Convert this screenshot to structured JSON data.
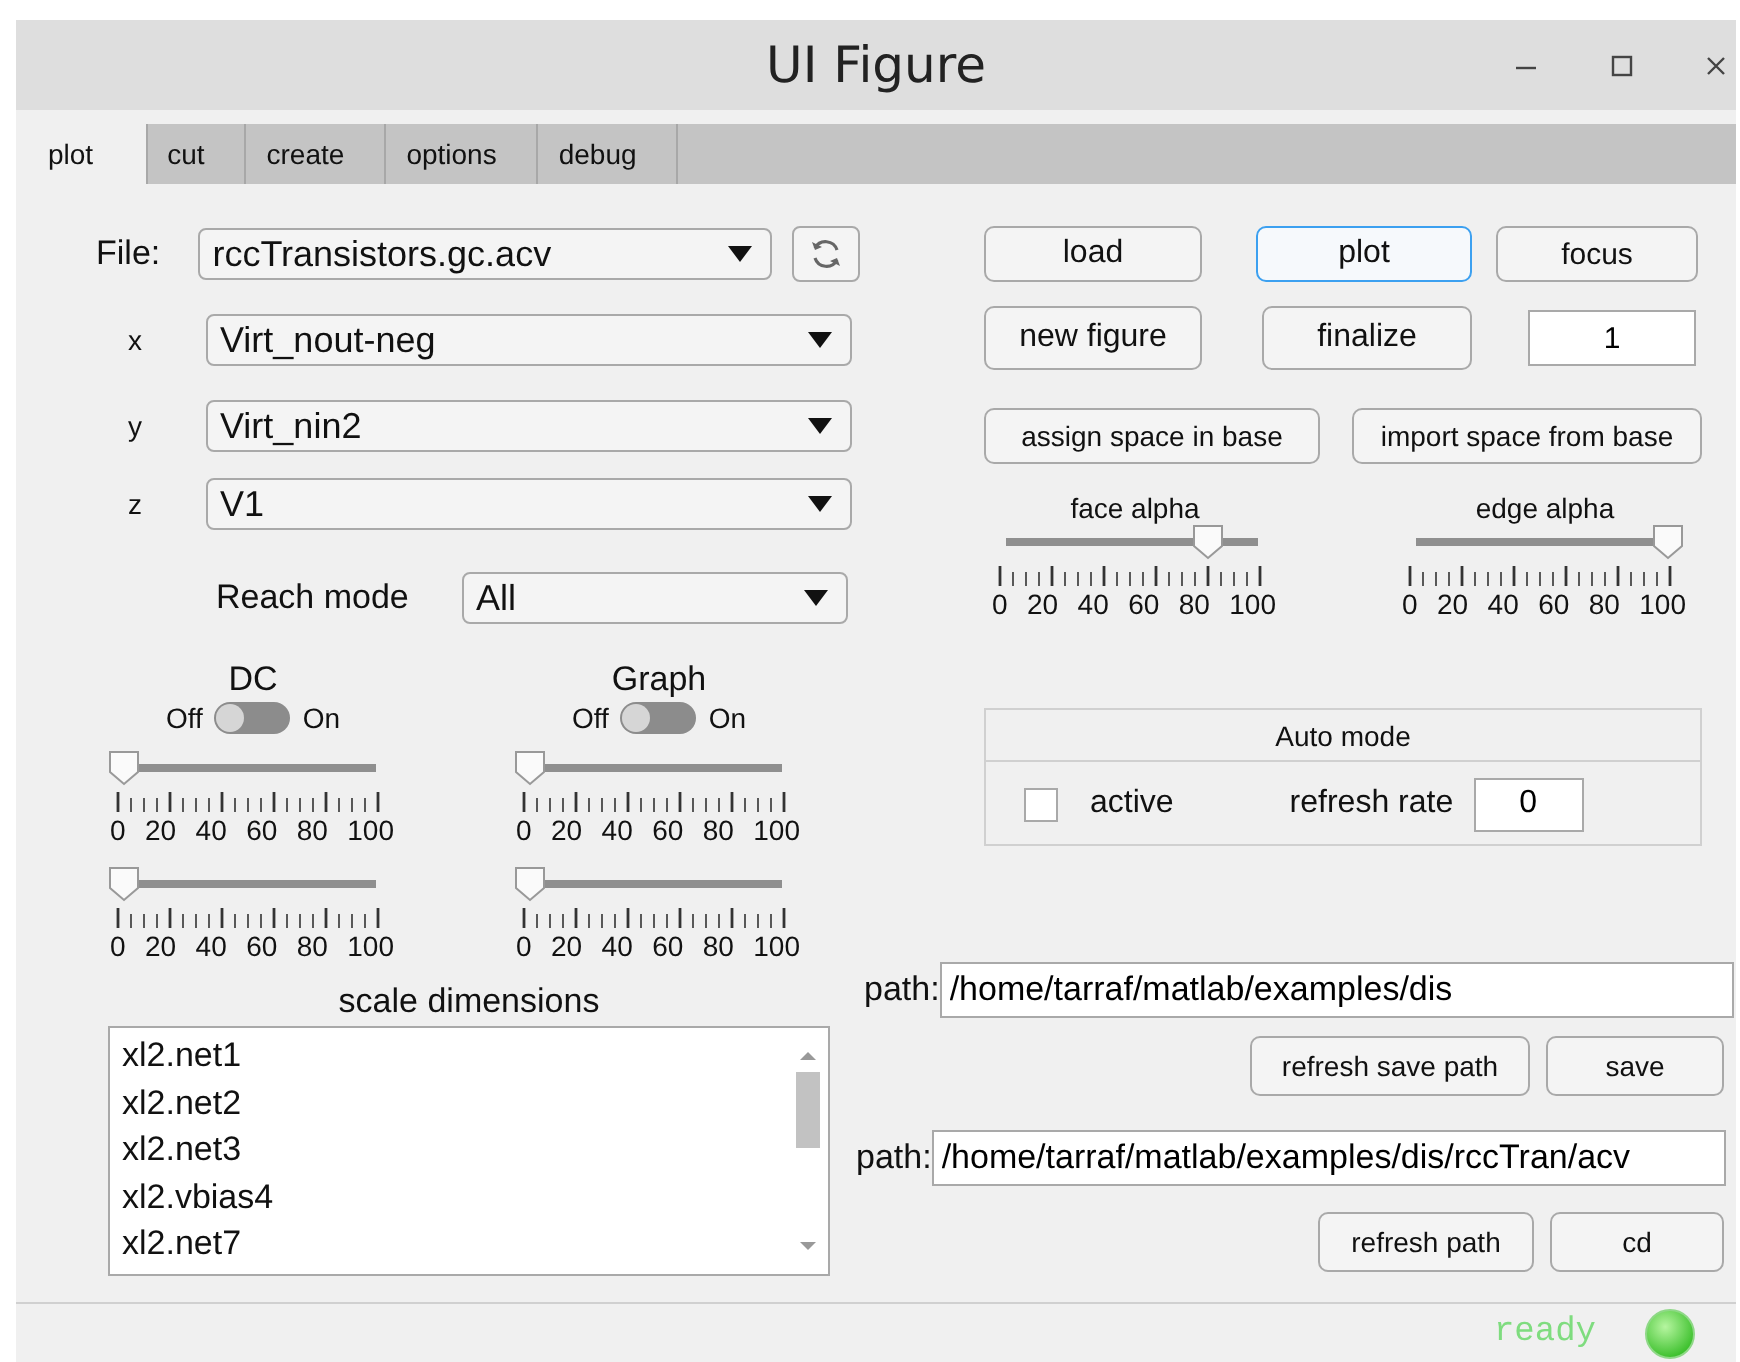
{
  "window": {
    "title": "UI Figure"
  },
  "tabs": [
    {
      "label": "plot",
      "selected": true
    },
    {
      "label": "cut",
      "selected": false
    },
    {
      "label": "create",
      "selected": false
    },
    {
      "label": "options",
      "selected": false
    },
    {
      "label": "debug",
      "selected": false
    }
  ],
  "file": {
    "label": "File:",
    "value": "rccTransistors.gc.acv"
  },
  "variables": [
    {
      "label": "x",
      "value": "Virt_nout-neg"
    },
    {
      "label": "y",
      "value": "Virt_nin2"
    },
    {
      "label": "z",
      "value": "V1"
    }
  ],
  "reach_mode": {
    "label": "Reach mode",
    "value": "All"
  },
  "toggles": [
    {
      "title": "DC",
      "off_label": "Off",
      "on_label": "On",
      "on": false,
      "sliders": [
        {
          "level": 0,
          "ticks": [
            "0",
            "20",
            "40",
            "60",
            "80",
            "100"
          ]
        },
        {
          "level": 0,
          "ticks": [
            "0",
            "20",
            "40",
            "60",
            "80",
            "100"
          ]
        }
      ]
    },
    {
      "title": "Graph",
      "off_label": "Off",
      "on_label": "On",
      "on": false,
      "sliders": [
        {
          "level": 0,
          "ticks": [
            "0",
            "20",
            "40",
            "60",
            "80",
            "100"
          ]
        },
        {
          "level": 0,
          "ticks": [
            "0",
            "20",
            "40",
            "60",
            "80",
            "100"
          ]
        }
      ]
    }
  ],
  "scale_dimensions": {
    "title": "scale dimensions",
    "items": [
      "xl2.net1",
      "xl2.net2",
      "xl2.net3",
      "xl2.vbias4",
      "xl2.net7"
    ]
  },
  "top_buttons": [
    {
      "label": "load",
      "focused": false
    },
    {
      "label": "plot",
      "focused": true
    },
    {
      "label": "focus",
      "focused": false
    }
  ],
  "second_row": {
    "buttons": [
      "new figure",
      "finalize"
    ],
    "field": "1"
  },
  "space_buttons": [
    "assign space in base",
    "import space from base"
  ],
  "alpha_sliders": [
    {
      "label": "face alpha",
      "level": 0.8,
      "ticks": [
        "0",
        "20",
        "40",
        "60",
        "80",
        "100"
      ]
    },
    {
      "label": "edge alpha",
      "level": 1,
      "ticks": [
        "0",
        "20",
        "40",
        "60",
        "80",
        "100"
      ]
    }
  ],
  "auto_mode": {
    "title": "Auto mode",
    "active_label": "active",
    "checked": false,
    "rate_label": "refresh rate",
    "rate": "0"
  },
  "paths": [
    {
      "label": "path:",
      "value": "/home/tarraf/matlab/examples/dis",
      "buttons": [
        "refresh save path",
        "save"
      ]
    },
    {
      "label": "path:",
      "value": "/home/tarraf/matlab/examples/dis/rccTran/acv",
      "buttons": [
        "refresh path",
        "cd"
      ]
    }
  ],
  "status": {
    "text": "ready"
  }
}
